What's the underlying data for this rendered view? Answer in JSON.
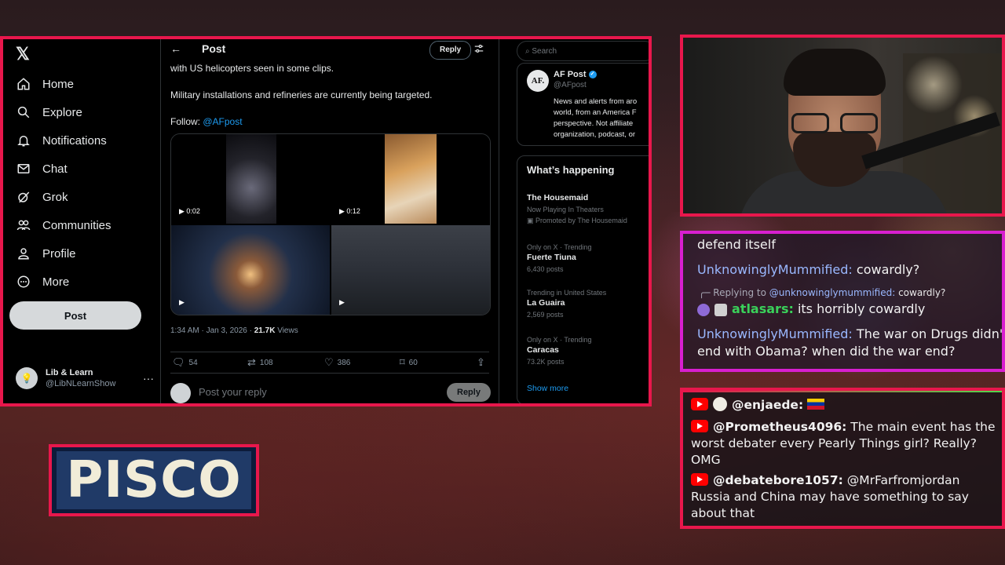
{
  "x_app": {
    "nav": [
      {
        "label": "Home",
        "icon": "home-icon"
      },
      {
        "label": "Explore",
        "icon": "search-icon"
      },
      {
        "label": "Notifications",
        "icon": "bell-icon"
      },
      {
        "label": "Chat",
        "icon": "mail-icon"
      },
      {
        "label": "Grok",
        "icon": "grok-icon"
      },
      {
        "label": "Communities",
        "icon": "communities-icon"
      },
      {
        "label": "Profile",
        "icon": "person-icon"
      },
      {
        "label": "More",
        "icon": "more-icon"
      }
    ],
    "post_button": "Post",
    "account": {
      "name": "Lib & Learn",
      "handle": "@LibNLearnShow"
    },
    "header": {
      "title": "Post",
      "reply_label": "Reply"
    },
    "tweet": {
      "line1": "with US helicopters seen in some clips.",
      "line2": "Military installations and refineries are currently being targeted.",
      "follow_prefix": "Follow: ",
      "follow_link": "@AFpost",
      "video1_duration": "0:02",
      "video2_duration": "0:12",
      "time": "1:34 AM · Jan 3, 2026 · ",
      "views_count": "21.7K",
      "views_label": " Views",
      "replies": "54",
      "reposts": "108",
      "likes": "386",
      "bookmarks": "60"
    },
    "reply_box": {
      "placeholder": "Post your reply",
      "button": "Reply"
    },
    "search_placeholder": "Search",
    "profile_card": {
      "avatar": "AF.",
      "name": "AF Post",
      "handle": "@AFpost",
      "bio": [
        "News and alerts from aro",
        "world, from an America F",
        "perspective. Not affiliate",
        "organization, podcast, or"
      ]
    },
    "whats_happening": {
      "title": "What’s happening",
      "trends": [
        {
          "ctx": "",
          "name": "The Housemaid",
          "sub": "Now Playing In Theaters",
          "count": "Promoted by The Housemaid"
        },
        {
          "ctx": "Only on X · Trending",
          "name": "Fuerte Tiuna",
          "sub": "",
          "count": "6,430 posts"
        },
        {
          "ctx": "Trending in United States",
          "name": "La Guaira",
          "sub": "",
          "count": "2,569 posts"
        },
        {
          "ctx": "Only on X · Trending",
          "name": "Caracas",
          "sub": "",
          "count": "73.2K posts"
        }
      ],
      "show_more": "Show more"
    }
  },
  "chat_top": {
    "line0": "defend itself",
    "m1_user": "UnknowinglyMummified:",
    "m1_text": " cowardly?",
    "reply_prefix": "Replying to ",
    "reply_mention": "@unknowinglymummified:",
    "reply_msg": " cowardly?",
    "m2_user": "atlasars:",
    "m2_text": " its horribly cowardly",
    "m3_user": "UnknowinglyMummified:",
    "m3_text": " The war on Drugs didn't",
    "m3_text2": "end with Obama? when did the war end?"
  },
  "chat_bottom": {
    "m1_user": "@enjaede:",
    "m2_user": "@Prometheus4096:",
    "m2_text": " The main event has the worst debater every Pearly Things girl? Really? OMG",
    "m3_user": "@debatebore1057:",
    "m3_text": " @MrFarfromjordan Russia and China may have something to say about that"
  },
  "overlay": {
    "name_tag": "PISCO"
  }
}
